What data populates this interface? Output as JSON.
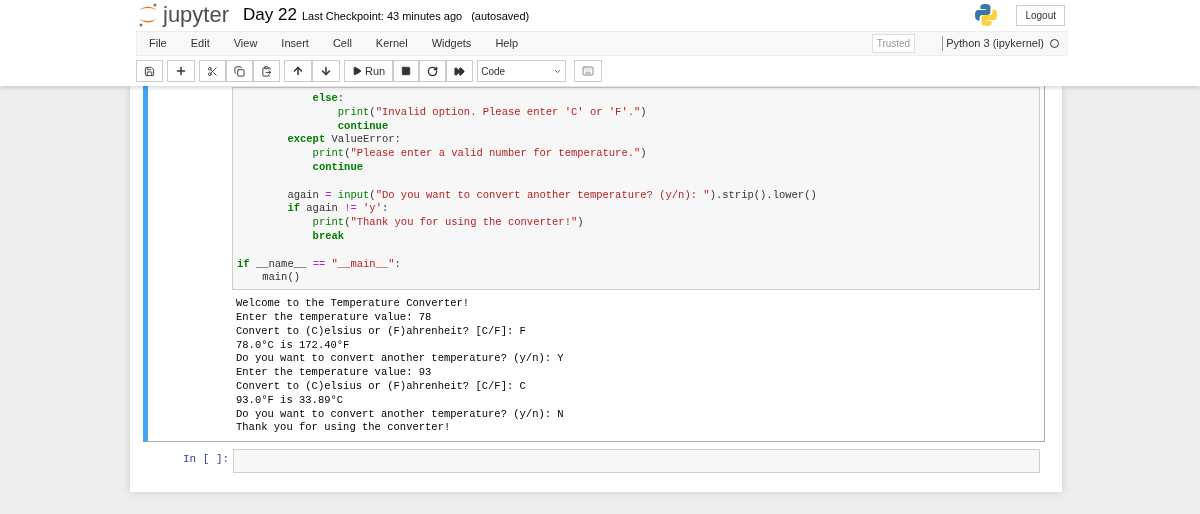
{
  "header": {
    "logo_text": "jupyter",
    "notebook_name": "Day 22",
    "checkpoint": "Last Checkpoint: 43 minutes ago",
    "autosave": "(autosaved)",
    "logout": "Logout"
  },
  "menu": [
    "File",
    "Edit",
    "View",
    "Insert",
    "Cell",
    "Kernel",
    "Widgets",
    "Help"
  ],
  "trusted": "Trusted",
  "kernel": {
    "name": "Python 3 (ipykernel)",
    "busy": false
  },
  "toolbar": {
    "run_label": "Run",
    "cell_type": "Code"
  },
  "cells": [
    {
      "selected": true,
      "code_lines": [
        {
          "kind": "code",
          "tokens": [
            {
              "kind": "kw",
              "s": "            else"
            },
            {
              "kind": "plain",
              "s": ":"
            }
          ]
        },
        {
          "kind": "code",
          "tokens": [
            {
              "kind": "builtin",
              "s": "                print"
            },
            {
              "kind": "plain",
              "s": "("
            },
            {
              "kind": "str",
              "s": "\"Invalid option. Please enter 'C' or 'F'.\""
            },
            {
              "kind": "plain",
              "s": ")"
            }
          ]
        },
        {
          "kind": "code",
          "tokens": [
            {
              "kind": "kw",
              "s": "                continue"
            }
          ]
        },
        {
          "kind": "code",
          "tokens": [
            {
              "kind": "kw",
              "s": "        except"
            },
            {
              "kind": "plain",
              "s": " ValueError:"
            }
          ]
        },
        {
          "kind": "code",
          "tokens": [
            {
              "kind": "builtin",
              "s": "            print"
            },
            {
              "kind": "plain",
              "s": "("
            },
            {
              "kind": "str",
              "s": "\"Please enter a valid number for temperature.\""
            },
            {
              "kind": "plain",
              "s": ")"
            }
          ]
        },
        {
          "kind": "code",
          "tokens": [
            {
              "kind": "kw",
              "s": "            continue"
            }
          ]
        },
        {
          "kind": "blank"
        },
        {
          "kind": "code",
          "tokens": [
            {
              "kind": "plain",
              "s": "        again "
            },
            {
              "kind": "op",
              "s": "="
            },
            {
              "kind": "builtin",
              "s": " input"
            },
            {
              "kind": "plain",
              "s": "("
            },
            {
              "kind": "str",
              "s": "\"Do you want to convert another temperature? (y/n): \""
            },
            {
              "kind": "plain",
              "s": ").strip().lower()"
            }
          ]
        },
        {
          "kind": "code",
          "tokens": [
            {
              "kind": "kw",
              "s": "        if"
            },
            {
              "kind": "plain",
              "s": " again "
            },
            {
              "kind": "op",
              "s": "!="
            },
            {
              "kind": "str",
              "s": " 'y'"
            },
            {
              "kind": "plain",
              "s": ":"
            }
          ]
        },
        {
          "kind": "code",
          "tokens": [
            {
              "kind": "builtin",
              "s": "            print"
            },
            {
              "kind": "plain",
              "s": "("
            },
            {
              "kind": "str",
              "s": "\"Thank you for using the converter!\""
            },
            {
              "kind": "plain",
              "s": ")"
            }
          ]
        },
        {
          "kind": "code",
          "tokens": [
            {
              "kind": "kw",
              "s": "            break"
            }
          ]
        },
        {
          "kind": "blank"
        },
        {
          "kind": "code",
          "tokens": [
            {
              "kind": "kw",
              "s": "if"
            },
            {
              "kind": "plain",
              "s": " __name__ "
            },
            {
              "kind": "op",
              "s": "=="
            },
            {
              "kind": "str",
              "s": " \"__main__\""
            },
            {
              "kind": "plain",
              "s": ":"
            }
          ]
        },
        {
          "kind": "code",
          "tokens": [
            {
              "kind": "plain",
              "s": "    main()"
            }
          ]
        }
      ],
      "output_lines": [
        "Welcome to the Temperature Converter!",
        "Enter the temperature value: 78",
        "Convert to (C)elsius or (F)ahrenheit? [C/F]: F",
        "78.0°C is 172.40°F",
        "Do you want to convert another temperature? (y/n): Y",
        "Enter the temperature value: 93",
        "Convert to (C)elsius or (F)ahrenheit? [C/F]: C",
        "93.0°F is 33.89°C",
        "Do you want to convert another temperature? (y/n): N",
        "Thank you for using the converter!"
      ]
    },
    {
      "selected": false,
      "prompt": "In [ ]:"
    }
  ]
}
